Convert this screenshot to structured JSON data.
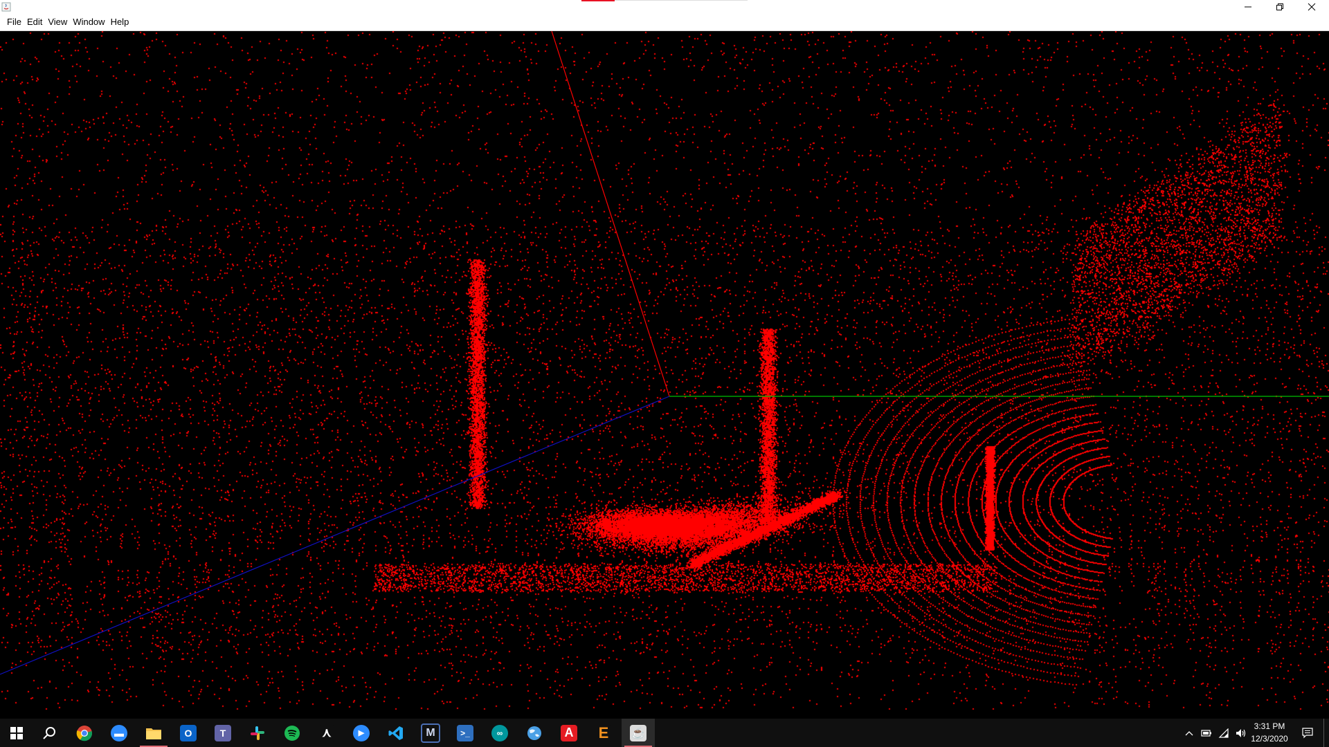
{
  "window": {
    "title": "",
    "controls": [
      "minimize-icon",
      "restore-icon",
      "close-icon"
    ]
  },
  "menu": {
    "items": [
      "File",
      "Edit",
      "View",
      "Window",
      "Help"
    ]
  },
  "viewport": {
    "background": "#000000",
    "point_color": "#ff0000",
    "axis_colors": {
      "x": "#ff0000",
      "y": "#00c000",
      "z": "#1010c0"
    }
  },
  "taskbar": {
    "background": "#101010",
    "apps": [
      {
        "name": "start-icon",
        "color": "#ffffff"
      },
      {
        "name": "search-icon",
        "color": "#ffffff"
      },
      {
        "name": "chrome-icon",
        "color": "#db4437"
      },
      {
        "name": "zoom-chat-icon",
        "color": "#2d8cff"
      },
      {
        "name": "file-explorer-icon",
        "color": "#f2c14e"
      },
      {
        "name": "outlook-icon",
        "color": "#0a64c8"
      },
      {
        "name": "teams-icon",
        "color": "#6264a7"
      },
      {
        "name": "slack-icon",
        "color": "#e01e5a"
      },
      {
        "name": "spotify-icon",
        "color": "#1db954"
      },
      {
        "name": "acrobat-icon",
        "color": "#ffffff"
      },
      {
        "name": "zoom-icon",
        "color": "#2d8cff"
      },
      {
        "name": "vscode-icon",
        "color": "#23a9f2"
      },
      {
        "name": "matlab-icon",
        "color": "#4b6fb5"
      },
      {
        "name": "powershell-icon",
        "color": "#2e6fbf"
      },
      {
        "name": "arduino-icon",
        "color": "#00979d"
      },
      {
        "name": "globe-icon",
        "color": "#4aa0e6"
      },
      {
        "name": "autocad-icon",
        "color": "#e51c23"
      },
      {
        "name": "e-app-icon",
        "color": "#f0901e"
      },
      {
        "name": "java-icon",
        "color": "#e76f00"
      }
    ],
    "tray": [
      "chevron-up-icon",
      "battery-icon",
      "wifi-icon",
      "volume-icon"
    ],
    "time": "3:31 PM",
    "date": "12/3/2020",
    "notification_icon": "notification-icon"
  }
}
